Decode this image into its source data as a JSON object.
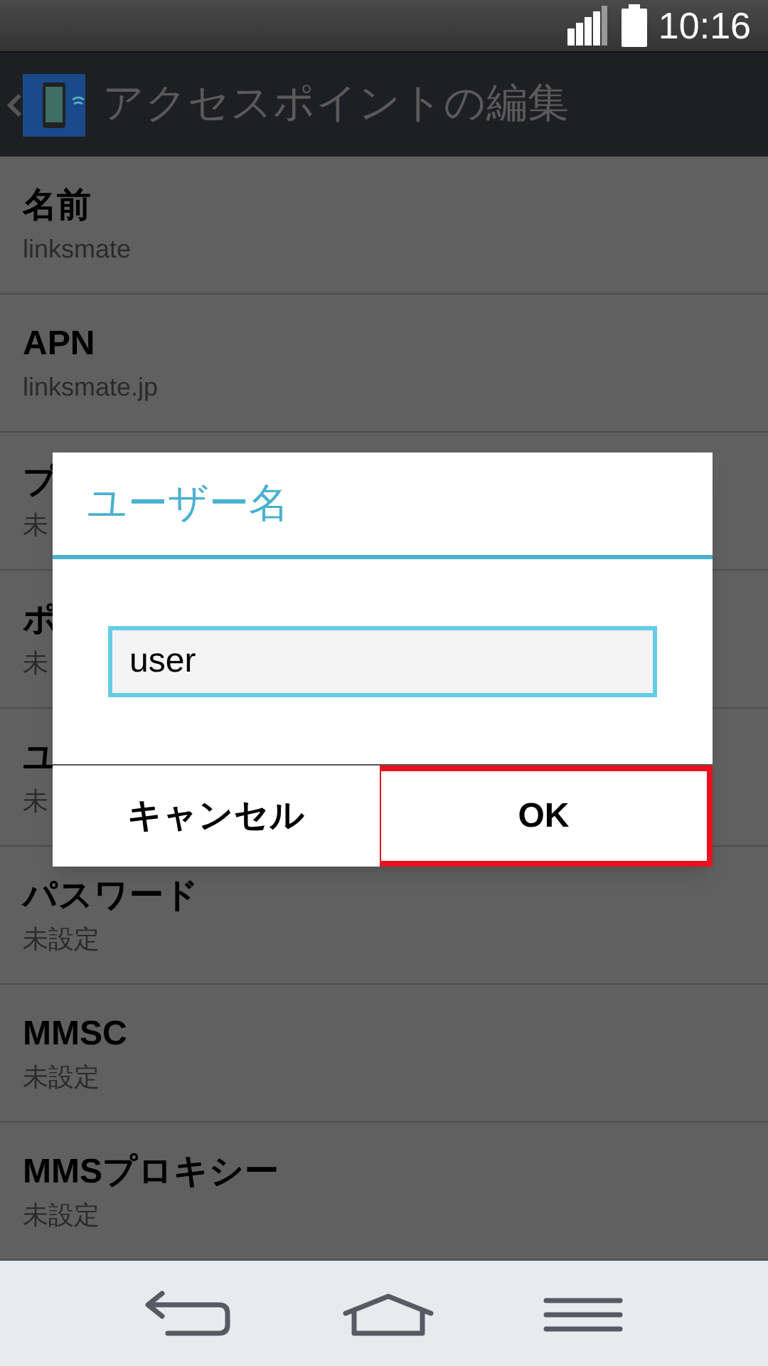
{
  "status_bar": {
    "time": "10:16"
  },
  "action_bar": {
    "title": "アクセスポイントの編集"
  },
  "settings": [
    {
      "title": "名前",
      "value": "linksmate"
    },
    {
      "title": "APN",
      "value": "linksmate.jp"
    },
    {
      "title": "プ",
      "value": "未"
    },
    {
      "title": "ポ",
      "value": "未"
    },
    {
      "title": "ユ",
      "value": "未"
    },
    {
      "title": "パスワード",
      "value": "未設定"
    },
    {
      "title": "MMSC",
      "value": "未設定"
    },
    {
      "title": "MMSプロキシー",
      "value": "未設定"
    }
  ],
  "dialog": {
    "title": "ユーザー名",
    "input_value": "user",
    "buttons": [
      {
        "label": "キャンセル",
        "highlighted": false
      },
      {
        "label": "OK",
        "highlighted": true
      }
    ]
  }
}
